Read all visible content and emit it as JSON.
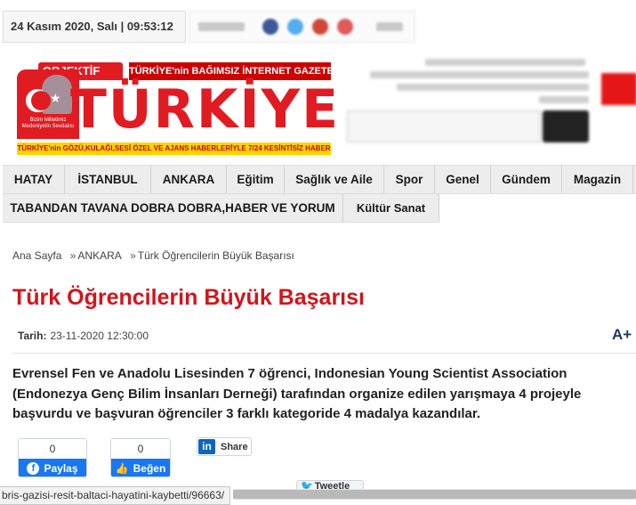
{
  "topbar": {
    "datetime": "24 Kasım 2020, Salı | 09:53:12"
  },
  "logo": {
    "objektif": "OBJEKTİF",
    "slogan": "TÜRKİYE'nin BAĞIMSIZ İNTERNET GAZETESİ",
    "word": "TÜRKİYE",
    "bottom_line": "TÜRKİYE'nin GÖZÜ,KULAĞI,SESİ ÖZEL VE AJANS HABERLERİYLE 7/24 KESİNTİSİZ HABER",
    "portrait_caption": "Bizim Milletimiz Medeniyetin Sevdalısı"
  },
  "nav": {
    "row1": [
      "HATAY",
      "İSTANBUL",
      "ANKARA",
      "Eğitim",
      "Sağlık ve Aile",
      "Spor",
      "Genel",
      "Gündem",
      "Magazin"
    ],
    "row2": [
      "TABANDAN TAVANA DOBRA DOBRA,HABER VE YORUM",
      "Kültür Sanat"
    ]
  },
  "breadcrumb": [
    "Ana Sayfa",
    "ANKARA",
    "Türk Öğrencilerin Büyük Başarısı"
  ],
  "article": {
    "title": "Türk Öğrencilerin Büyük Başarısı",
    "date_label": "Tarih:",
    "date_value": "23-11-2020 12:30:00",
    "font_control": "A+ A",
    "lead": "Evrensel Fen ve Anadolu Lisesinden 7 öğrenci, Indonesian Young Scientist Association (Endonezya Genç Bilim İnsanları Derneği) tarafından organize edilen yarışmaya 4 projeyle başvurdu ve başvuran öğrenciler 3 farklı kategoride 4 madalya kazandılar."
  },
  "share": {
    "fb_share_count": "0",
    "fb_share_label": "Paylaş",
    "fb_like_count": "0",
    "fb_like_label": "Beğen",
    "linkedin_icon": "in",
    "linkedin_label": "Share",
    "tweet_label": "Tweetle"
  },
  "statusbar": {
    "url": "bris-gazisi-resit-baltaci-hayatini-kaybetti/96663/"
  },
  "colors": {
    "brand_red": "#e11b22",
    "title_red": "#d3141b",
    "facebook_blue": "#1877f2",
    "linkedin_blue": "#0a66c2"
  },
  "icons": [
    "facebook-icon",
    "like-thumb-icon",
    "linkedin-icon",
    "twitter-bird-icon",
    "crescent-star-icon"
  ]
}
